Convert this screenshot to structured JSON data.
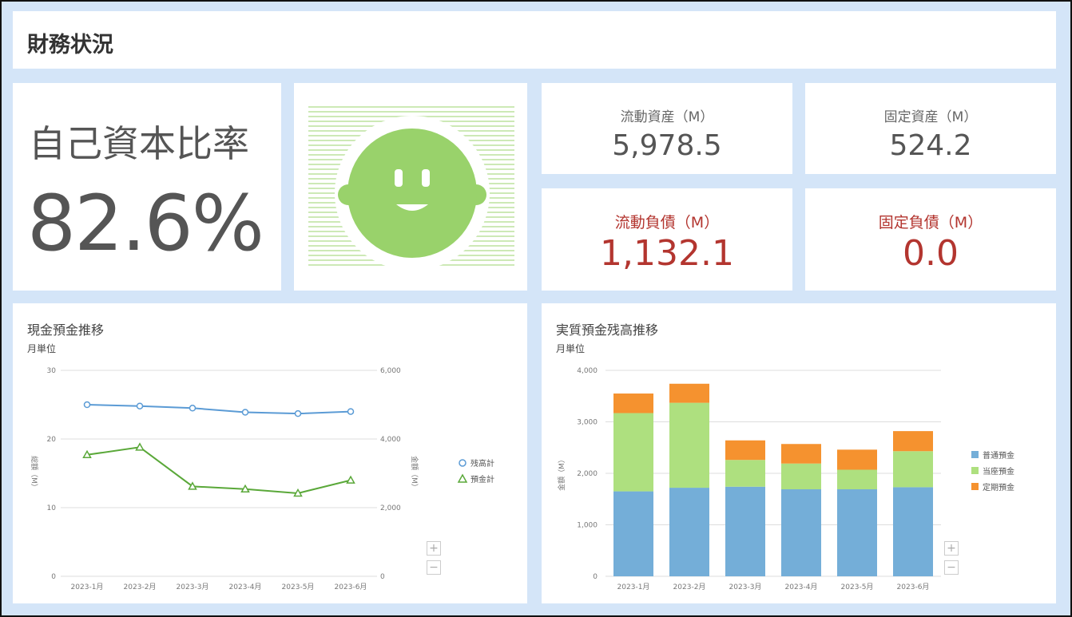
{
  "header": {
    "title": "財務状況"
  },
  "equity": {
    "label": "自己資本比率",
    "value": "82.6%"
  },
  "face": {
    "icon": "smiley-face-icon",
    "color": "#99d26b"
  },
  "kpis": [
    {
      "label": "流動資産（M）",
      "value": "5,978.5",
      "status": "normal"
    },
    {
      "label": "固定資産（M）",
      "value": "524.2",
      "status": "normal"
    },
    {
      "label": "流動負債（M）",
      "value": "1,132.1",
      "status": "alert"
    },
    {
      "label": "固定負債（M）",
      "value": "0.0",
      "status": "alert"
    }
  ],
  "colors": {
    "background": "#d4e5f8",
    "alert": "#b3352f",
    "text": "#555555"
  },
  "charts": {
    "cash": {
      "title": "現金預金推移",
      "unit": "月単位",
      "zoom_in": "+",
      "zoom_out": "−"
    },
    "deposit": {
      "title": "実質預金残高推移",
      "unit": "月単位",
      "zoom_in": "+",
      "zoom_out": "−"
    }
  },
  "chart_data": [
    {
      "type": "line",
      "title": "現金預金推移",
      "categories": [
        "2023-1月",
        "2023-2月",
        "2023-3月",
        "2023-4月",
        "2023-5月",
        "2023-6月"
      ],
      "ylim": [
        0,
        30
      ],
      "yticks": [
        "0",
        "10",
        "20",
        "30"
      ],
      "ylabel": "総額（M）",
      "y2lim": [
        0,
        6000
      ],
      "y2ticks": [
        "0",
        "2,000",
        "4,000",
        "6,000"
      ],
      "y2label": "金額（M）",
      "legend": "right",
      "series": [
        {
          "name": "残高計",
          "marker": "circle",
          "color": "#5b9bd5",
          "values": [
            25.0,
            24.8,
            24.5,
            23.9,
            23.7,
            24.0
          ]
        },
        {
          "name": "預金計",
          "marker": "triangle",
          "color": "#5aa839",
          "values": [
            17.7,
            18.8,
            13.1,
            12.7,
            12.1,
            14.0
          ]
        }
      ]
    },
    {
      "type": "bar",
      "stacked": true,
      "title": "実質預金残高推移",
      "categories": [
        "2023-1月",
        "2023-2月",
        "2023-3月",
        "2023-4月",
        "2023-5月",
        "2023-6月"
      ],
      "ylim": [
        0,
        4000
      ],
      "yticks": [
        "0",
        "1,000",
        "2,000",
        "3,000",
        "4,000"
      ],
      "ylabel": "金額（M）",
      "legend": "right",
      "series": [
        {
          "name": "普通預金",
          "color": "#74aed8",
          "values": [
            1650,
            1720,
            1740,
            1690,
            1690,
            1730
          ]
        },
        {
          "name": "当座預金",
          "color": "#aee07f",
          "values": [
            1520,
            1650,
            520,
            500,
            380,
            700
          ]
        },
        {
          "name": "定期預金",
          "color": "#f5922f",
          "values": [
            380,
            370,
            380,
            380,
            390,
            390
          ]
        }
      ]
    }
  ]
}
